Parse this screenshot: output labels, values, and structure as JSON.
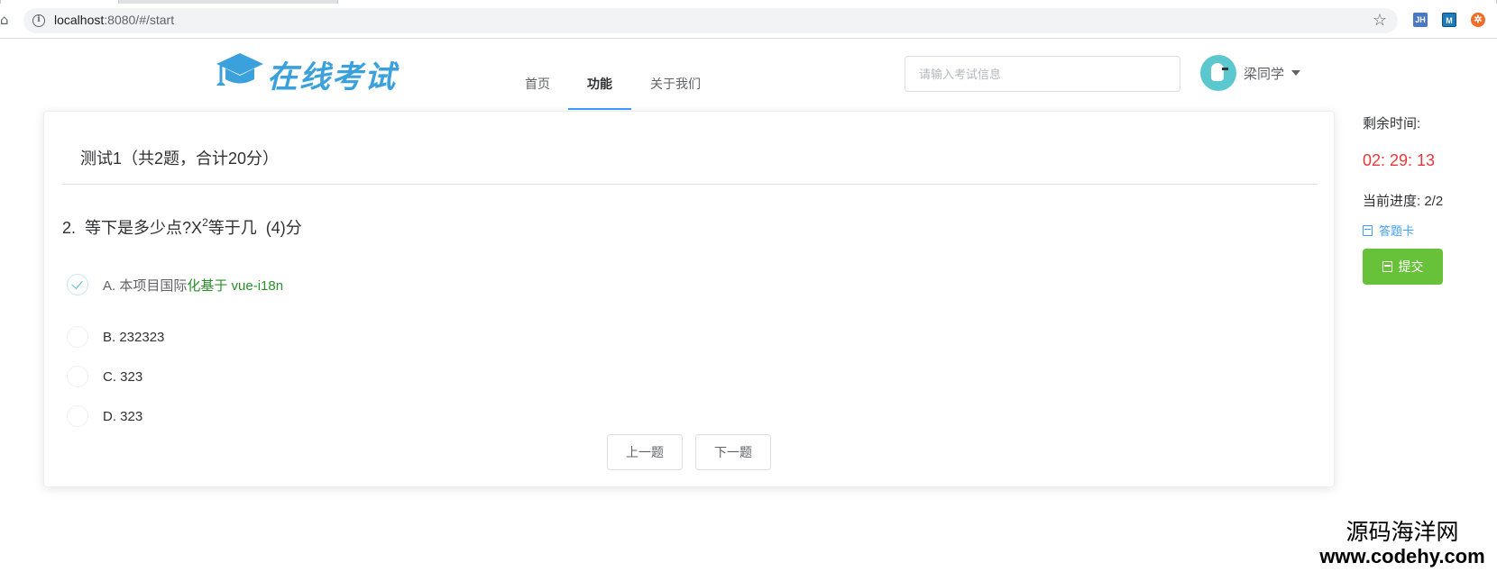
{
  "browser": {
    "url_host": "localhost",
    "url_rest": ":8080/#/start",
    "extensions": [
      "JH",
      "M",
      "✲"
    ]
  },
  "site": {
    "logo_text": "在线考试",
    "nav": [
      {
        "label": "首页",
        "active": false
      },
      {
        "label": "功能",
        "active": true
      },
      {
        "label": "关于我们",
        "active": false
      }
    ],
    "search_placeholder": "请输入考试信息",
    "user_name": "梁同学"
  },
  "exam": {
    "title": "测试1（共2题，合计20分）",
    "question": {
      "number": "2.",
      "text_before": "等下是多少点?X",
      "superscript": "2",
      "text_after": "等于几",
      "score": "(4)分"
    },
    "options": [
      {
        "label": "A. 本项目国际",
        "label_highlight": "化基于 vue-i18n",
        "selected": true
      },
      {
        "label": "B. 232323",
        "label_highlight": "",
        "selected": false
      },
      {
        "label": "C. 323",
        "label_highlight": "",
        "selected": false
      },
      {
        "label": "D. 323",
        "label_highlight": "",
        "selected": false
      }
    ],
    "prev_label": "上一题",
    "next_label": "下一题"
  },
  "side": {
    "remaining_label": "剩余时间:",
    "timer": "02: 29: 13",
    "progress_label": "当前进度: 2/2",
    "answer_card_label": "答题卡",
    "submit_label": "提交"
  },
  "watermark": {
    "line1": "源码海洋网",
    "line2": "www.codehy.com"
  },
  "colors": {
    "primary": "#409eff",
    "success": "#67c23a",
    "danger": "#e23a3a",
    "logo": "#3aa1dc",
    "avatar": "#5bc7cf"
  }
}
